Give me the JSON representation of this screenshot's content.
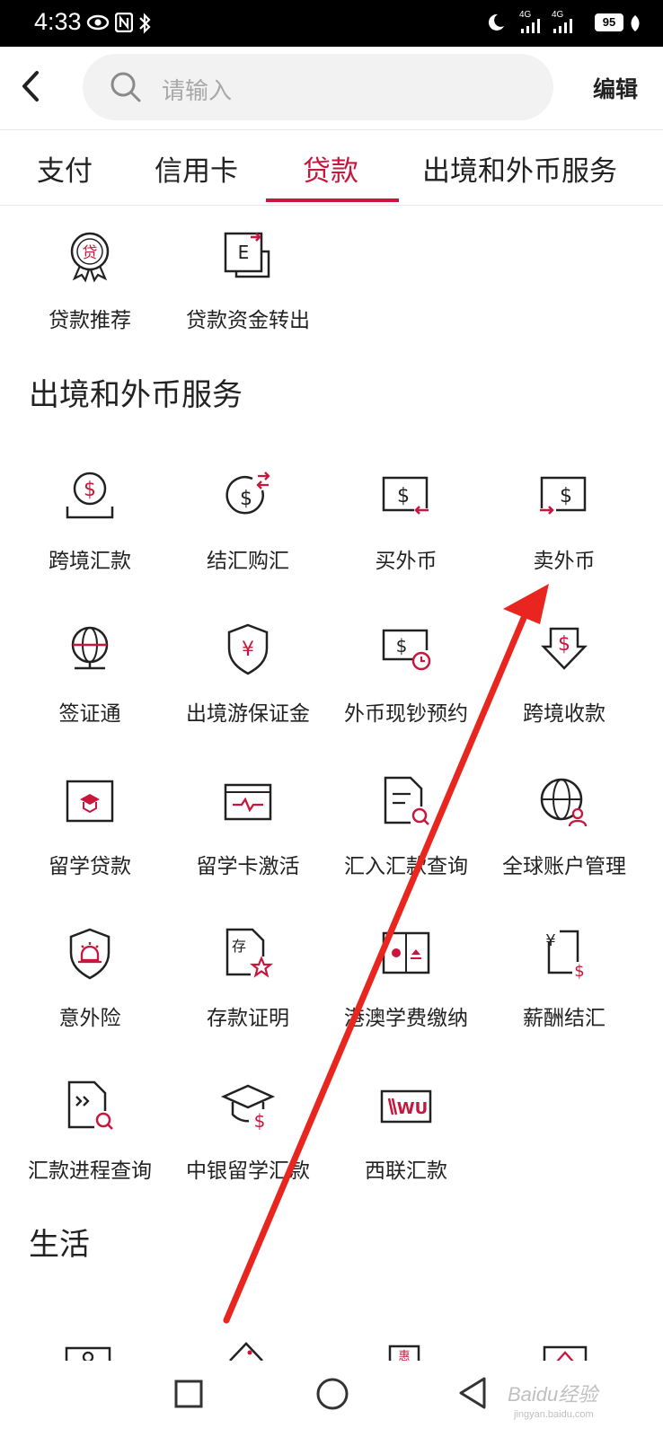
{
  "status_bar": {
    "time": "4:33",
    "network_1": "4G",
    "network_2": "4G",
    "battery": "95"
  },
  "header": {
    "search_placeholder": "请输入",
    "edit_label": "编辑"
  },
  "tabs": [
    {
      "label": "支付",
      "active": false
    },
    {
      "label": "信用卡",
      "active": false
    },
    {
      "label": "贷款",
      "active": true
    },
    {
      "label": "出境和外币服务",
      "active": false
    }
  ],
  "loan_items": [
    {
      "label": "贷款推荐",
      "icon": "loan-badge-icon"
    },
    {
      "label": "贷款资金转出",
      "icon": "fund-transfer-icon"
    }
  ],
  "section_forex": {
    "title": "出境和外币服务",
    "items": [
      {
        "label": "跨境汇款",
        "icon": "cross-border-remit-icon"
      },
      {
        "label": "结汇购汇",
        "icon": "exchange-icon"
      },
      {
        "label": "买外币",
        "icon": "buy-forex-icon"
      },
      {
        "label": "卖外币",
        "icon": "sell-forex-icon"
      },
      {
        "label": "签证通",
        "icon": "visa-globe-icon"
      },
      {
        "label": "出境游保证金",
        "icon": "shield-yuan-icon"
      },
      {
        "label": "外币现钞预约",
        "icon": "cash-reservation-icon"
      },
      {
        "label": "跨境收款",
        "icon": "cross-border-receive-icon"
      },
      {
        "label": "留学贷款",
        "icon": "study-loan-icon"
      },
      {
        "label": "留学卡激活",
        "icon": "card-activate-icon"
      },
      {
        "label": "汇入汇款查询",
        "icon": "inbound-query-icon"
      },
      {
        "label": "全球账户管理",
        "icon": "global-account-icon"
      },
      {
        "label": "意外险",
        "icon": "accident-insurance-icon"
      },
      {
        "label": "存款证明",
        "icon": "deposit-certificate-icon"
      },
      {
        "label": "港澳学费缴纳",
        "icon": "hk-macau-tuition-icon"
      },
      {
        "label": "薪酬结汇",
        "icon": "salary-exchange-icon"
      },
      {
        "label": "汇款进程查询",
        "icon": "remit-progress-icon"
      },
      {
        "label": "中银留学汇款",
        "icon": "study-abroad-remit-icon"
      },
      {
        "label": "西联汇款",
        "icon": "western-union-icon"
      }
    ]
  },
  "section_life": {
    "title": "生活"
  },
  "icon_glyphs": {
    "loan_char": "贷",
    "deposit_char": "存",
    "wu_text": "WU",
    "dollar": "$",
    "yuan": "¥",
    "partial_char": "惠"
  },
  "colors": {
    "accent": "#c8163d",
    "annotation_arrow": "#e8261f"
  },
  "watermark": {
    "brand": "Baidu经验",
    "url": "jingyan.baidu.com"
  }
}
